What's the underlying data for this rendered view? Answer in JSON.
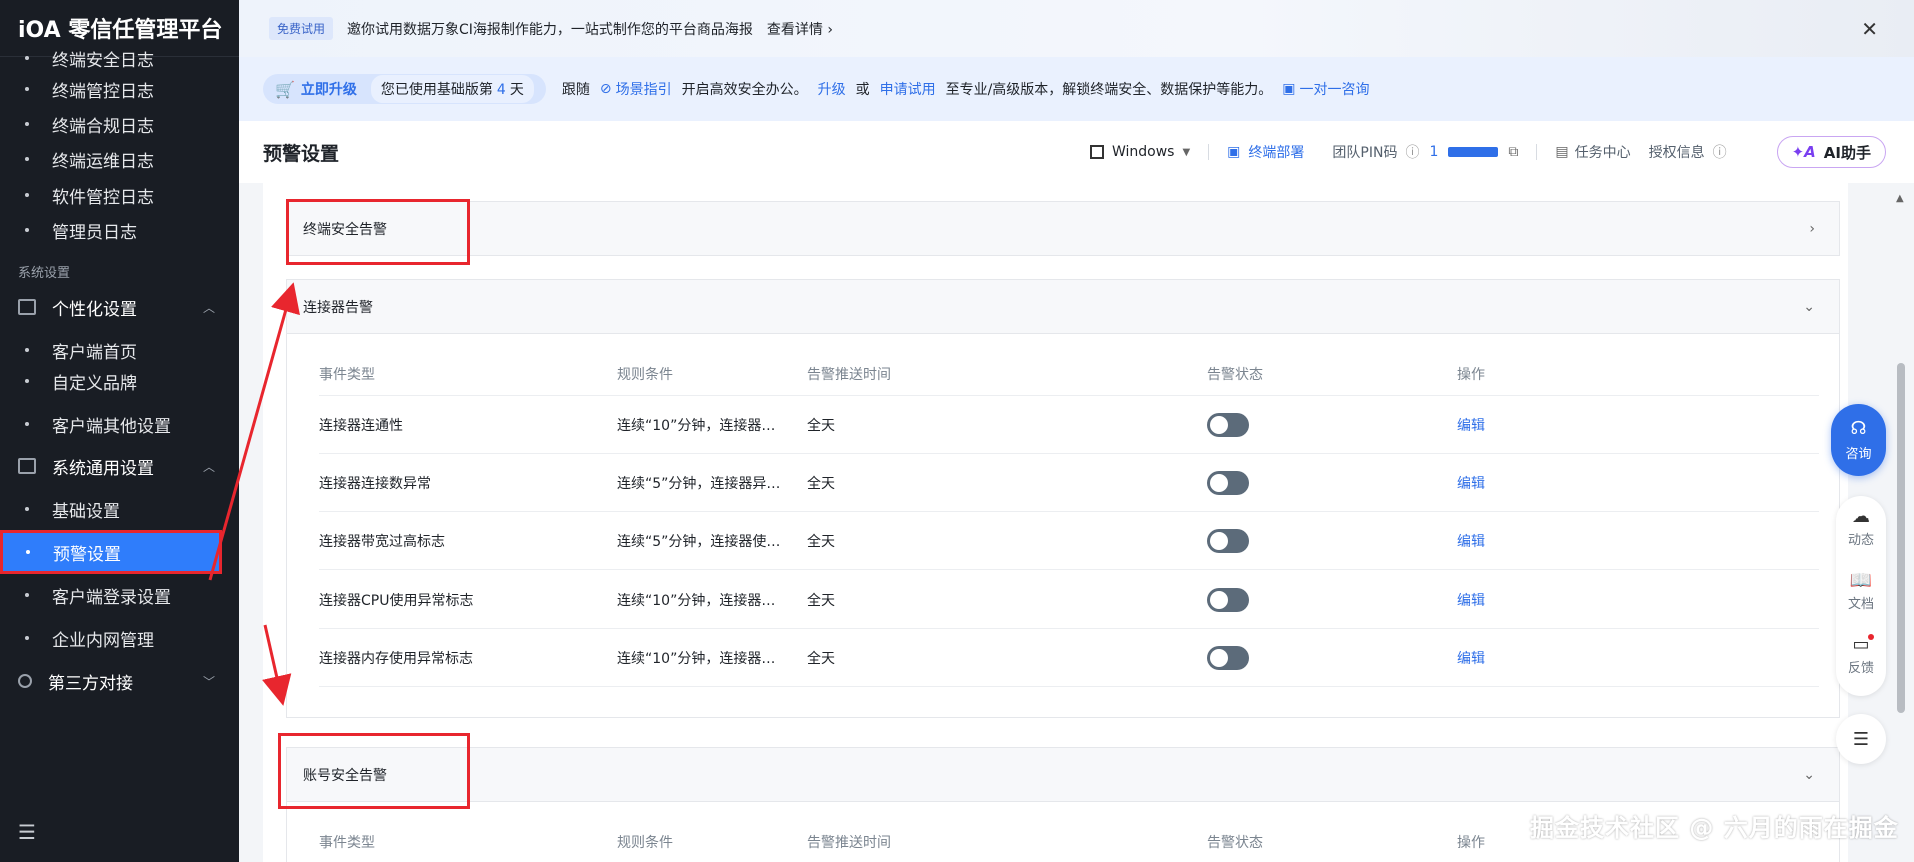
{
  "app": {
    "title": "iOA 零信任管理平台"
  },
  "sidebar": {
    "items_top": [
      "终端安全日志",
      "终端管控日志",
      "终端合规日志",
      "终端运维日志",
      "软件管控日志",
      "管理员日志"
    ],
    "section_label": "系统设置",
    "group_personal": "个性化设置",
    "personal_items": [
      "客户端首页",
      "自定义品牌",
      "客户端其他设置"
    ],
    "group_general": "系统通用设置",
    "general_items": [
      "基础设置",
      "预警设置",
      "客户端登录设置",
      "企业内网管理"
    ],
    "group_third": "第三方对接",
    "active_item": "预警设置"
  },
  "banner": {
    "badge": "免费试用",
    "text": "邀你试用数据万象CI海报制作能力，一站式制作您的平台商品海报",
    "more": "查看详情 ›",
    "close": "✕"
  },
  "upgrade": {
    "button": "立即升级",
    "days_prefix": "您已使用基础版第",
    "days": "4",
    "days_suffix": "天",
    "follow": "跟随",
    "guide": "场景指引",
    "guide_tail": "开启高效安全办公。",
    "upgrade_link": "升级",
    "or": "或",
    "trial_link": "申请试用",
    "tail": "至专业/高级版本，解锁终端安全、数据保护等能力。",
    "consult_link": "一对一咨询"
  },
  "header": {
    "title": "预警设置",
    "os": "Windows",
    "deploy": "终端部署",
    "pin_label": "团队PIN码",
    "pin_visible": "1",
    "task_center": "任务中心",
    "auth_info": "授权信息",
    "ai_button": "AI助手"
  },
  "sections": {
    "terminal": "终端安全告警",
    "connector": "连接器告警",
    "account": "账号安全告警"
  },
  "table": {
    "headers": [
      "事件类型",
      "规则条件",
      "告警推送时间",
      "告警状态",
      "操作"
    ],
    "rows": [
      {
        "type": "连接器连通性",
        "rule": "连续“10”分钟，连接器…",
        "time": "全天",
        "action": "编辑"
      },
      {
        "type": "连接器连接数异常",
        "rule": "连续“5”分钟，连接器异…",
        "time": "全天",
        "action": "编辑"
      },
      {
        "type": "连接器带宽过高标志",
        "rule": "连续“5”分钟，连接器使…",
        "time": "全天",
        "action": "编辑"
      },
      {
        "type": "连接器CPU使用异常标志",
        "rule": "连续“10”分钟，连接器…",
        "time": "全天",
        "action": "编辑"
      },
      {
        "type": "连接器内存使用异常标志",
        "rule": "连续“10”分钟，连接器…",
        "time": "全天",
        "action": "编辑"
      }
    ]
  },
  "float": {
    "consult": "咨询",
    "dynamic": "动态",
    "docs": "文档",
    "feedback": "反馈"
  },
  "watermark": "掘金技术社区 @ 六月的雨在掘金",
  "colors": {
    "primary": "#2f6fe8",
    "sidebar_bg": "#191d24",
    "annotation": "#e8262e"
  }
}
